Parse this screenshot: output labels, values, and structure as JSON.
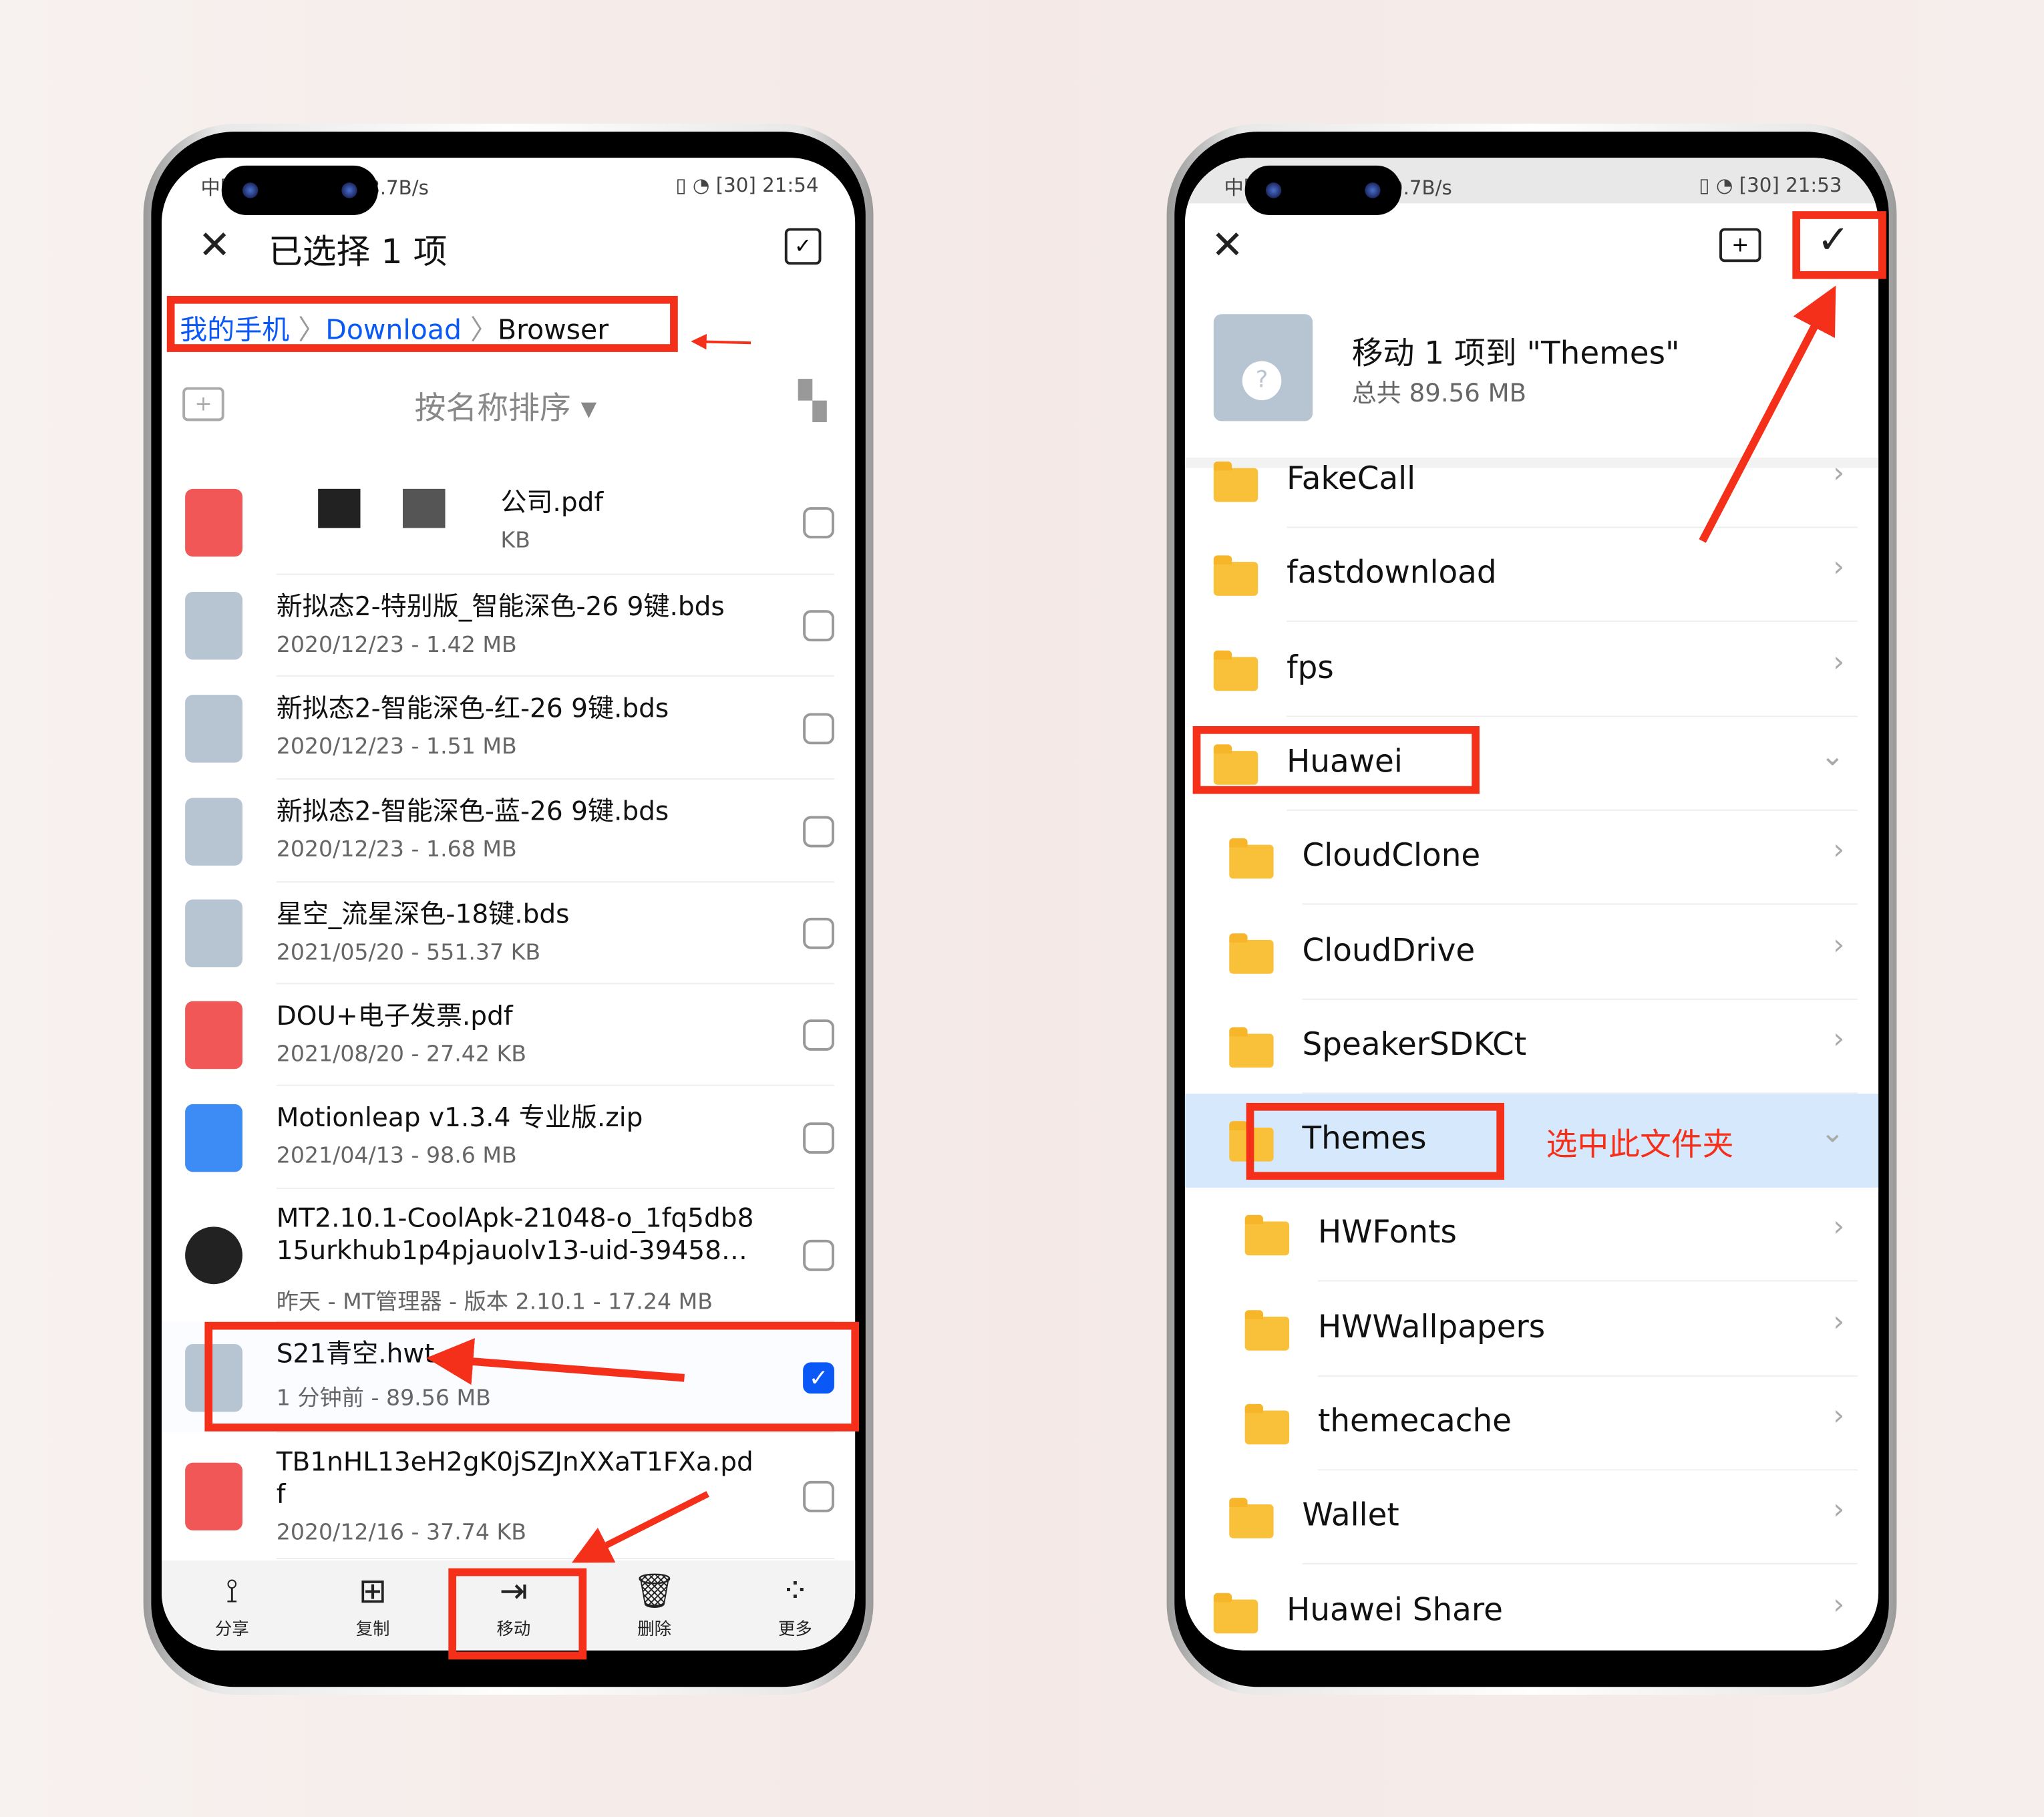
{
  "left": {
    "status": {
      "carrier": "中国电信 HD 5G",
      "speed": "18.7B/s",
      "battery": "30",
      "time": "21:54"
    },
    "header": {
      "title": "已选择 1 项"
    },
    "breadcrumb": [
      {
        "label": "我的手机"
      },
      {
        "label": "Download"
      },
      {
        "label": "Browser"
      }
    ],
    "sort_label": "按名称排序",
    "files": [
      {
        "name": "公司.pdf",
        "meta": "KB",
        "type": "pdf",
        "checked": false,
        "redacted": true
      },
      {
        "name": "新拟态2-特别版_智能深色-26 9键.bds",
        "meta": "2020/12/23 - 1.42 MB",
        "type": "unknown",
        "checked": false
      },
      {
        "name": "新拟态2-智能深色-红-26 9键.bds",
        "meta": "2020/12/23 - 1.51 MB",
        "type": "unknown",
        "checked": false
      },
      {
        "name": "新拟态2-智能深色-蓝-26 9键.bds",
        "meta": "2020/12/23 - 1.68 MB",
        "type": "unknown",
        "checked": false
      },
      {
        "name": "星空_流星深色-18键.bds",
        "meta": "2021/05/20 - 551.37 KB",
        "type": "unknown",
        "checked": false
      },
      {
        "name": "DOU+电子发票.pdf",
        "meta": "2021/08/20 - 27.42 KB",
        "type": "pdf",
        "checked": false
      },
      {
        "name": "Motionleap v1.3.4 专业版.zip",
        "meta": "2021/04/13 - 98.6 MB",
        "type": "zip",
        "checked": false
      },
      {
        "name": "MT2.10.1-CoolApk-21048-o_1fq5db8\n15urkhub1p4pjauolv13-uid-39458…",
        "meta": "昨天 - MT管理器 - 版本 2.10.1 - 17.24 MB",
        "type": "apk",
        "checked": false
      },
      {
        "name": "S21青空.hwt",
        "meta": "1 分钟前 - 89.56 MB",
        "type": "unknown",
        "checked": true
      },
      {
        "name": "TB1nHL13eH2gK0jSZJnXXaT1FXa.pd\nf",
        "meta": "2020/12/16 - 37.74 KB",
        "type": "pdf",
        "checked": false
      }
    ],
    "toolbar": [
      {
        "label": "分享",
        "icon": "share-icon"
      },
      {
        "label": "复制",
        "icon": "copy-icon"
      },
      {
        "label": "移动",
        "icon": "move-icon"
      },
      {
        "label": "删除",
        "icon": "delete-icon"
      },
      {
        "label": "更多",
        "icon": "more-icon"
      }
    ]
  },
  "right": {
    "status": {
      "carrier": "中国电信 HD 5G",
      "speed": "99.7B/s",
      "battery": "30",
      "time": "21:53"
    },
    "move_title": "移动 1 项到 \"Themes\"",
    "move_total": "总共 89.56 MB",
    "folders": [
      {
        "name": "FakeCall",
        "level": 0,
        "expanded": false
      },
      {
        "name": "fastdownload",
        "level": 0,
        "expanded": false
      },
      {
        "name": "fps",
        "level": 0,
        "expanded": false
      },
      {
        "name": "Huawei",
        "level": 0,
        "expanded": true
      },
      {
        "name": "CloudClone",
        "level": 1,
        "expanded": false
      },
      {
        "name": "CloudDrive",
        "level": 1,
        "expanded": false
      },
      {
        "name": "SpeakerSDKCt",
        "level": 1,
        "expanded": false
      },
      {
        "name": "Themes",
        "level": 1,
        "expanded": true,
        "selected": true
      },
      {
        "name": "HWFonts",
        "level": 2,
        "expanded": false
      },
      {
        "name": "HWWallpapers",
        "level": 2,
        "expanded": false
      },
      {
        "name": "themecache",
        "level": 2,
        "expanded": false
      },
      {
        "name": "Wallet",
        "level": 1,
        "expanded": false
      },
      {
        "name": "Huawei Share",
        "level": 0,
        "expanded": false
      }
    ],
    "annotation": "选中此文件夹"
  },
  "colors": {
    "accent": "#0a59f7",
    "annotation": "#f5301a",
    "selected_bg": "#d6e8fb",
    "folder": "#f9c13a",
    "pdf": "#f25757",
    "unknown": "#b7c5d3",
    "zip": "#3d8cf5"
  }
}
